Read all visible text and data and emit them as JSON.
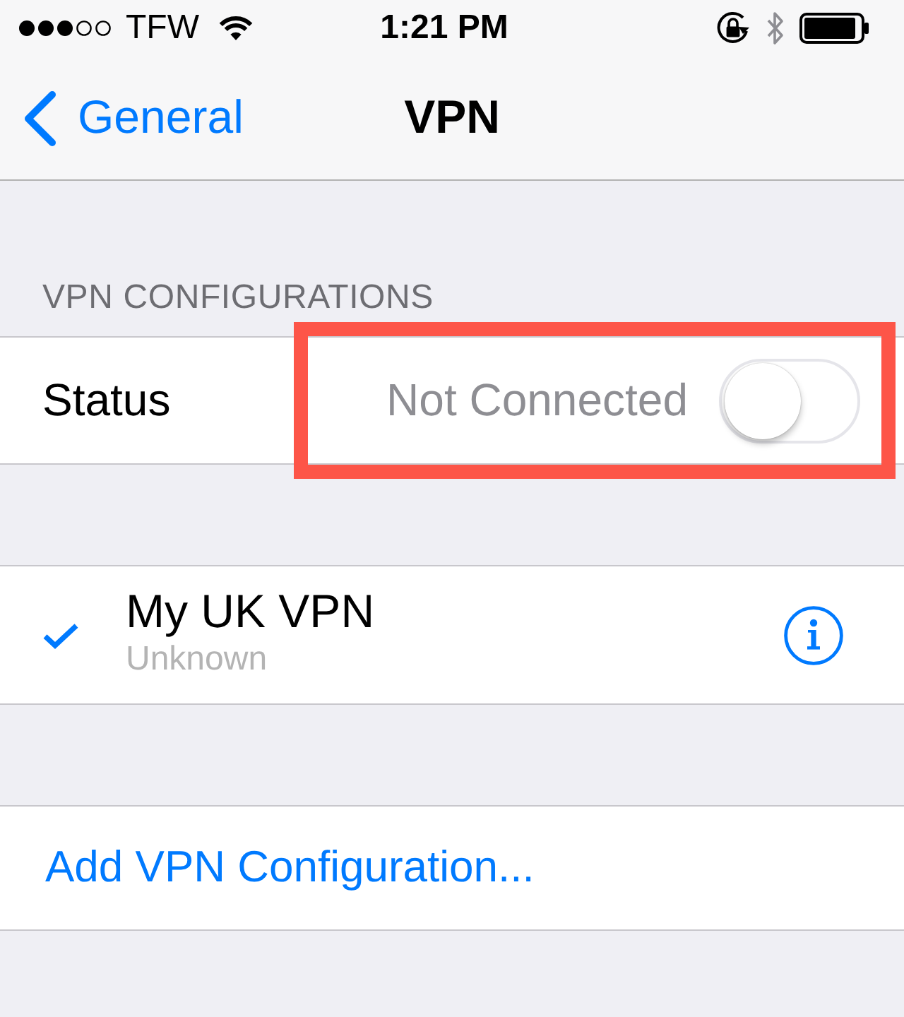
{
  "status_bar": {
    "carrier": "TFW",
    "time": "1:21 PM"
  },
  "nav_bar": {
    "back_label": "General",
    "title": "VPN"
  },
  "section_header": "VPN CONFIGURATIONS",
  "status_row": {
    "label": "Status",
    "value": "Not Connected",
    "on": false
  },
  "configurations": [
    {
      "name": "My UK VPN",
      "detail": "Unknown",
      "selected": true
    }
  ],
  "add_row": {
    "label": "Add VPN Configuration..."
  }
}
